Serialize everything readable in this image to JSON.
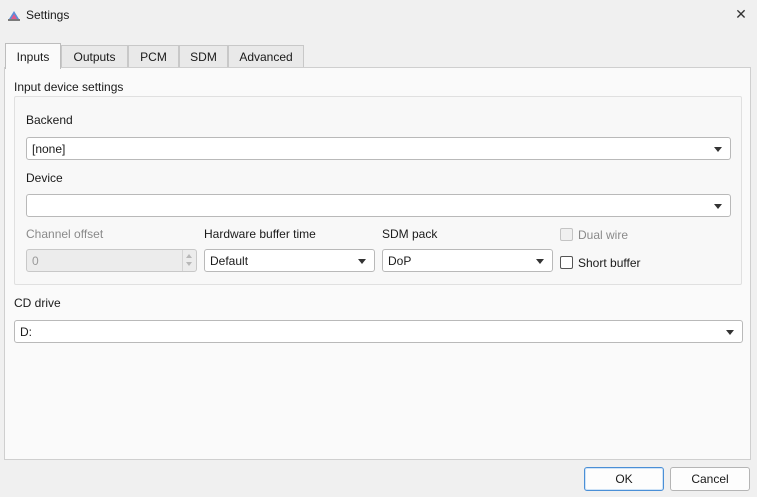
{
  "window": {
    "title": "Settings",
    "close_glyph": "✕"
  },
  "tabs": [
    {
      "label": "Inputs",
      "active": true
    },
    {
      "label": "Outputs",
      "active": false
    },
    {
      "label": "PCM",
      "active": false
    },
    {
      "label": "SDM",
      "active": false
    },
    {
      "label": "Advanced",
      "active": false
    }
  ],
  "input_device": {
    "group_title": "Input device settings",
    "backend_label": "Backend",
    "backend_value": "[none]",
    "device_label": "Device",
    "device_value": "",
    "channel_offset_label": "Channel offset",
    "channel_offset_value": "0",
    "hw_buffer_label": "Hardware buffer time",
    "hw_buffer_value": "Default",
    "sdm_pack_label": "SDM pack",
    "sdm_pack_value": "DoP",
    "dual_wire_label": "Dual wire",
    "short_buffer_label": "Short buffer"
  },
  "cd_drive": {
    "label": "CD drive",
    "value": "D:"
  },
  "buttons": {
    "ok": "OK",
    "cancel": "Cancel"
  }
}
